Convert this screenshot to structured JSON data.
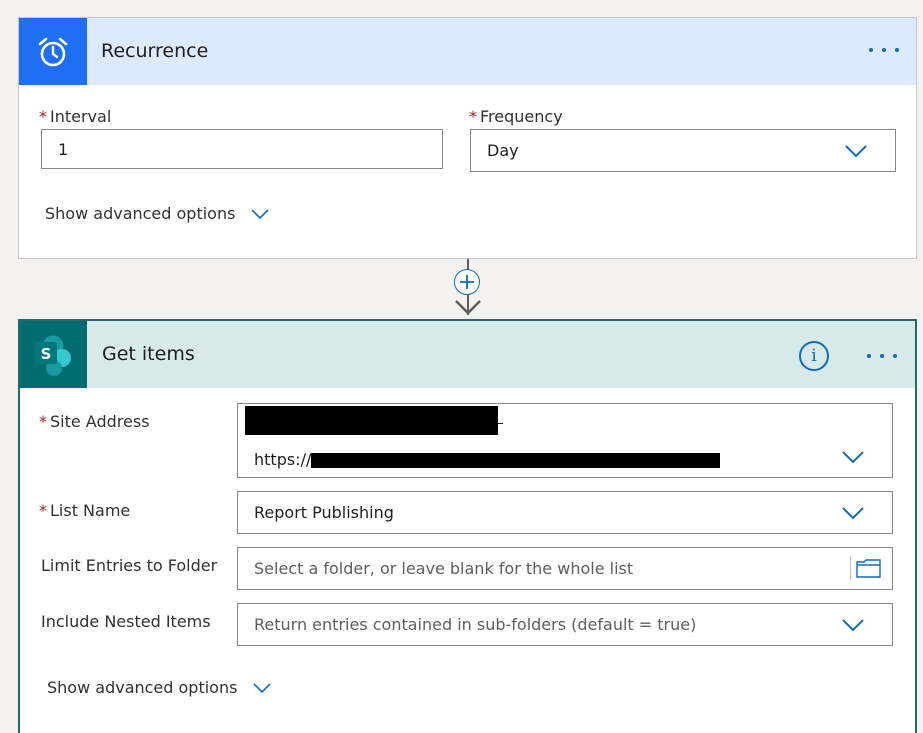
{
  "recurrence": {
    "title": "Recurrence",
    "icon": "alarm-clock-icon",
    "interval_label": "Interval",
    "interval_value": "1",
    "frequency_label": "Frequency",
    "frequency_value": "Day",
    "advanced_label": "Show advanced options"
  },
  "connector": {
    "icon": "plus-icon"
  },
  "get_items": {
    "title": "Get items",
    "icon": "sharepoint-icon",
    "icon_letter": "S",
    "site_address_label": "Site Address",
    "site_address_value": "https://",
    "list_name_label": "List Name",
    "list_name_value": "Report Publishing",
    "limit_label": "Limit Entries to Folder",
    "limit_placeholder": "Select a folder, or leave blank for the whole list",
    "nested_label": "Include Nested Items",
    "nested_value": "Return entries contained in sub-folders (default = true)",
    "advanced_label": "Show advanced options"
  },
  "colors": {
    "accent": "#0f6cbd",
    "recurrence_header": "#dceafe",
    "recurrence_icon_bg": "#1e6ff2",
    "sharepoint_header": "#d8e9e9",
    "sharepoint_border": "#1f6c6c",
    "required_mark": "#a4262c"
  }
}
